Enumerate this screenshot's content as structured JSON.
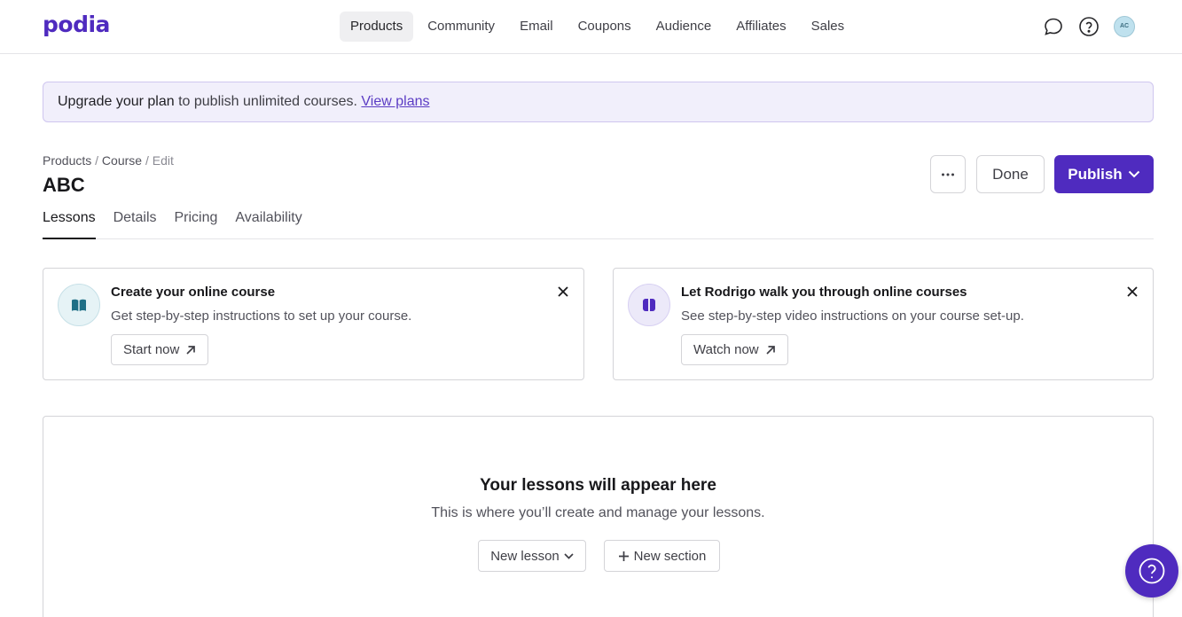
{
  "app": {
    "logo": "podia"
  },
  "nav": {
    "items": [
      {
        "label": "Products",
        "active": true
      },
      {
        "label": "Community"
      },
      {
        "label": "Email"
      },
      {
        "label": "Coupons"
      },
      {
        "label": "Audience"
      },
      {
        "label": "Affiliates"
      },
      {
        "label": "Sales"
      }
    ],
    "icons": [
      "chat-icon",
      "help-icon"
    ],
    "avatar_initials": "AC"
  },
  "banner": {
    "strong": "Upgrade your plan",
    "text": " to publish unlimited courses. ",
    "link": "View plans"
  },
  "breadcrumb": {
    "items": [
      "Products",
      "Course"
    ],
    "separator": "/",
    "current": "Edit"
  },
  "page": {
    "title": "ABC"
  },
  "actions": {
    "more": "more-icon",
    "done": "Done",
    "publish": "Publish"
  },
  "tabs": [
    {
      "label": "Lessons",
      "active": true
    },
    {
      "label": "Details"
    },
    {
      "label": "Pricing"
    },
    {
      "label": "Availability"
    }
  ],
  "cards": [
    {
      "title": "Create your online course",
      "text": "Get step-by-step instructions to set up your course.",
      "button": "Start now",
      "icon": "book-icon"
    },
    {
      "title": "Let Rodrigo walk you through online courses",
      "text": "See step-by-step video instructions on your course set-up.",
      "button": "Watch now",
      "icon": "video-icon"
    }
  ],
  "lessons": {
    "empty_title": "Your lessons will appear here",
    "empty_text": "This is where you’ll create and manage your lessons.",
    "new_lesson": "New lesson",
    "new_section": "New section"
  },
  "colors": {
    "brand": "#4f2bbf",
    "banner_bg": "#f1effb",
    "avatar_bg": "#bfe1ee"
  }
}
